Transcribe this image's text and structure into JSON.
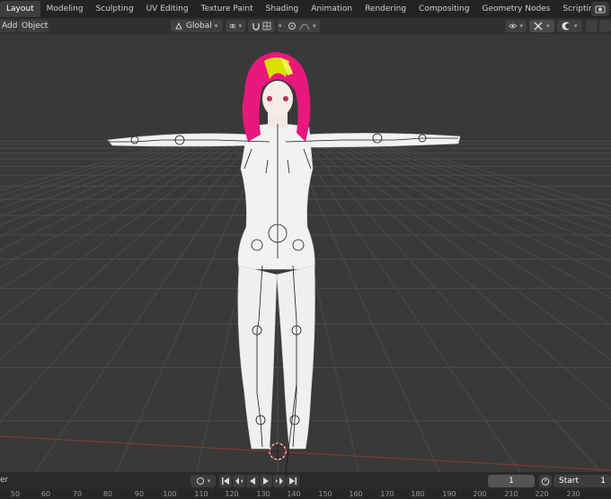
{
  "workspace_tabs": [
    "Layout",
    "Modeling",
    "Sculpting",
    "UV Editing",
    "Texture Paint",
    "Shading",
    "Animation",
    "Rendering",
    "Compositing",
    "Geometry Nodes",
    "Scripting",
    "+"
  ],
  "active_tab": "Layout",
  "viewport_header": {
    "add_label": "Add",
    "object_label": "Object",
    "transform_orientation": "Global"
  },
  "timeline": {
    "left_label": "er",
    "current_frame": "1",
    "start_label": "Start",
    "start_value": "1"
  },
  "ruler_ticks": [
    "50",
    "60",
    "70",
    "80",
    "90",
    "100",
    "110",
    "120",
    "130",
    "140",
    "150",
    "160",
    "170",
    "180",
    "190",
    "200",
    "210",
    "220",
    "230"
  ],
  "colors": {
    "hair_pink": "#e8187c",
    "hair_yellow": "#d9e000",
    "body_white": "#f2f2f2",
    "grid_line": "#4a4a4a",
    "x_axis_red": "#8a3a3a"
  }
}
